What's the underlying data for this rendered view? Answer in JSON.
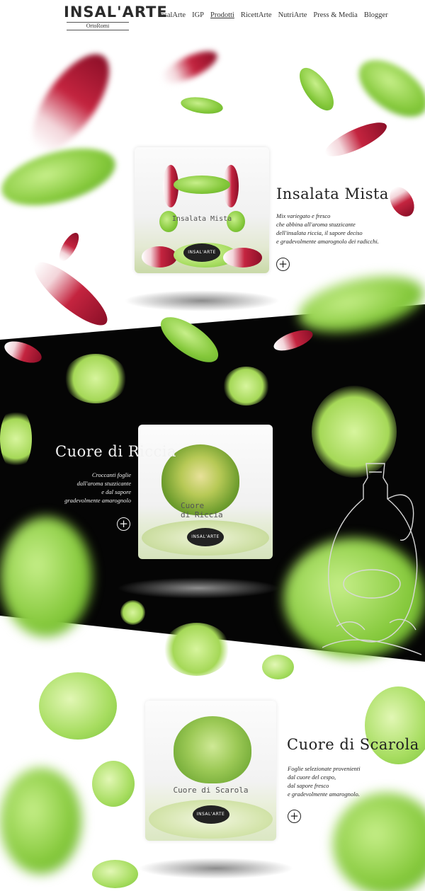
{
  "header": {
    "logo_main": "INSAL'ARTE",
    "logo_sub": "OrtoRomi",
    "nav": [
      {
        "label": "InsalArte",
        "active": false
      },
      {
        "label": "IGP",
        "active": false
      },
      {
        "label": "Prodotti",
        "active": true
      },
      {
        "label": "RicettArte",
        "active": false
      },
      {
        "label": "NutriArte",
        "active": false
      },
      {
        "label": "Press & Media",
        "active": false
      },
      {
        "label": "Blogger",
        "active": false
      }
    ]
  },
  "products": [
    {
      "name": "Insalata Mista",
      "bag_label": "Insalata Mista",
      "badge": "INSAL'ARTE",
      "description": "Mix variegato e fresco\nche abbina all'aroma stuzzicante\ndell'insalata riccia, il sapore deciso\ne gradevolmente amarognolo dei radicchi.",
      "more_icon": "plus-circle-icon"
    },
    {
      "name": "Cuore di Riccia",
      "bag_label": "Cuore\ndi Riccia",
      "badge": "INSAL'ARTE",
      "description": "Croccanti foglie\ndall'aroma stuzzicante\ne dal sapore\ngradevolmente amarognolo",
      "more_icon": "plus-circle-icon"
    },
    {
      "name": "Cuore di Scarola",
      "bag_label": "Cuore di Scarola",
      "badge": "INSAL'ARTE",
      "description": "Foglie selezionate provenienti\ndal cuore del cespo,\ndal sapore fresco\ne gradevolmente amarognolo.",
      "more_icon": "plus-circle-icon"
    }
  ],
  "colors": {
    "band": "#050505",
    "lettuce_green": "#8cc63f",
    "radicchio_red": "#b5183a"
  }
}
